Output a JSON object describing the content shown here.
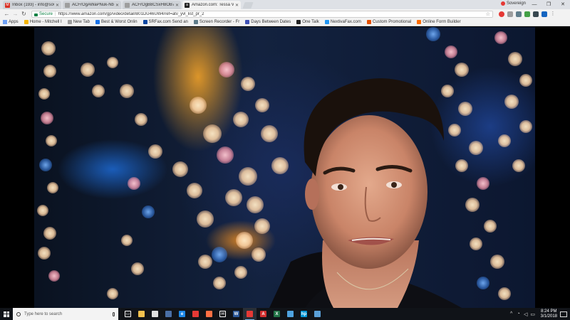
{
  "tabs": [
    {
      "title": "Inbox (193) - info@sov",
      "favicon": "gmail-icon",
      "color": "#d93025",
      "active": false
    },
    {
      "title": "ACFrOgAWaPNuk-NbAC",
      "favicon": "doc-icon",
      "color": "#9e9e9e",
      "active": false
    },
    {
      "title": "ACFrOgB8CSxH8OB7b",
      "favicon": "doc-icon",
      "color": "#9e9e9e",
      "active": false
    },
    {
      "title": "Amazon.com: Tessa V",
      "favicon": "amazon-icon",
      "color": "#222222",
      "active": true
    }
  ],
  "profile_name": "Sovereign",
  "address": {
    "secure_label": "Secure",
    "url": "https://www.amazon.com/gp/video/detail/B01DU46UW4/ref=atv_yvl_list_pr_2"
  },
  "bookmarks": {
    "apps_label": "Apps",
    "items": [
      {
        "label": "Home - Mitchell I",
        "color": "#f4b400"
      },
      {
        "label": "New Tab",
        "color": "#9e9e9e"
      },
      {
        "label": "Best & Worst Onlin",
        "color": "#1a73e8"
      },
      {
        "label": "SRFax.com Send an",
        "color": "#0d47a1"
      },
      {
        "label": "Screen Recorder - Fr",
        "color": "#607d8b"
      },
      {
        "label": "Days Between Dates",
        "color": "#3f51b5"
      },
      {
        "label": "One Talk",
        "color": "#222222"
      },
      {
        "label": "NextivaFax.com",
        "color": "#2196f3"
      },
      {
        "label": "Custom Promotional",
        "color": "#e65100"
      },
      {
        "label": "Online Form Builder",
        "color": "#ff6d00"
      }
    ]
  },
  "taskbar": {
    "search_placeholder": "Type here to search",
    "apps": [
      {
        "name": "task-view-icon",
        "glyph": "▭",
        "color": "#ffffff",
        "active": false
      },
      {
        "name": "file-explorer-icon",
        "glyph": "",
        "color": "#f2c14e",
        "active": false
      },
      {
        "name": "store-icon",
        "glyph": "",
        "color": "#e0e0e0",
        "active": false
      },
      {
        "name": "calculator-icon",
        "glyph": "",
        "color": "#4a6fa5",
        "active": false
      },
      {
        "name": "edge-icon",
        "glyph": "e",
        "color": "#1e88e5",
        "active": false
      },
      {
        "name": "chrome-icon",
        "glyph": "",
        "color": "#e53935",
        "active": false
      },
      {
        "name": "firefox-icon",
        "glyph": "",
        "color": "#ff7043",
        "active": false
      },
      {
        "name": "mail-icon",
        "glyph": "✉",
        "color": "#ffffff",
        "active": false
      },
      {
        "name": "word-icon",
        "glyph": "W",
        "color": "#2b5797",
        "active": false
      },
      {
        "name": "chrome-active-icon",
        "glyph": "",
        "color": "#e53935",
        "active": true
      },
      {
        "name": "acrobat-icon",
        "glyph": "A",
        "color": "#d32f2f",
        "active": false
      },
      {
        "name": "excel-icon",
        "glyph": "X",
        "color": "#217346",
        "active": false
      },
      {
        "name": "hp-support-icon",
        "glyph": "",
        "color": "#4fa3e0",
        "active": false
      },
      {
        "name": "hp-icon",
        "glyph": "hp",
        "color": "#0096d6",
        "active": false
      },
      {
        "name": "scanner-icon",
        "glyph": "",
        "color": "#5aa0d8",
        "active": false
      }
    ],
    "time": "8:24 PM",
    "date": "3/1/2018"
  }
}
